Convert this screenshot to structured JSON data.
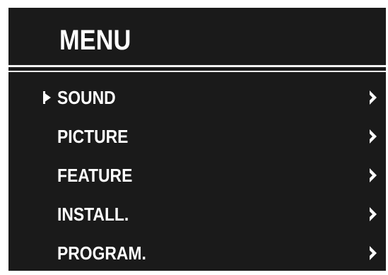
{
  "menu": {
    "title": "MENU",
    "selected_index": 0,
    "items": [
      {
        "label": "SOUND",
        "icon": "chevron-right-icon"
      },
      {
        "label": "PICTURE",
        "icon": "chevron-right-icon"
      },
      {
        "label": "FEATURE",
        "icon": "chevron-right-icon"
      },
      {
        "label": "INSTALL.",
        "icon": "chevron-right-icon"
      },
      {
        "label": "PROGRAM.",
        "icon": "chevron-right-icon"
      }
    ]
  },
  "colors": {
    "background": "#1a1a1a",
    "text": "#ffffff",
    "divider": "#f2f2f2"
  },
  "cursor_icon": "selection-cursor-icon"
}
